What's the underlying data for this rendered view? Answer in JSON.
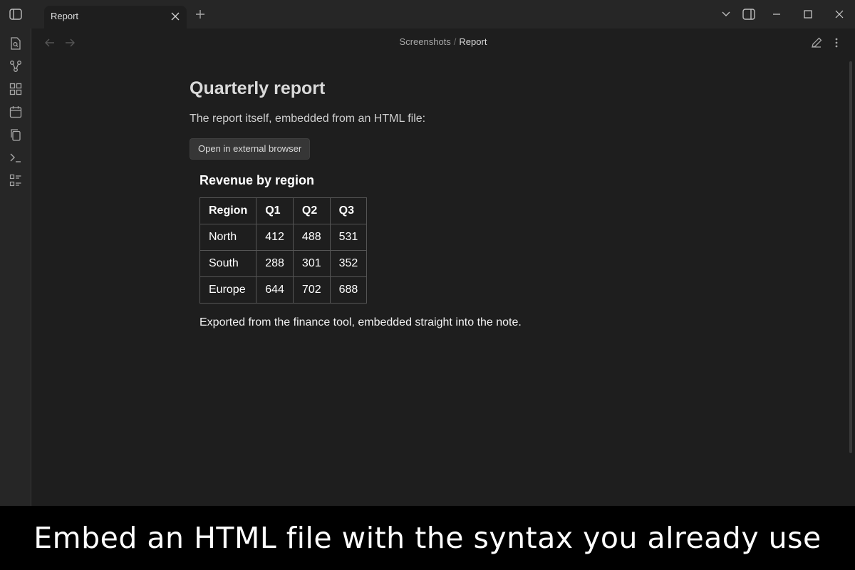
{
  "tab": {
    "title": "Report"
  },
  "breadcrumb": {
    "parent": "Screenshots",
    "separator": "/",
    "current": "Report"
  },
  "note": {
    "title": "Quarterly report",
    "paragraph": "The report itself, embedded from an HTML file:",
    "button_label": "Open in external browser"
  },
  "embed": {
    "heading": "Revenue by region",
    "table": {
      "headers": [
        "Region",
        "Q1",
        "Q2",
        "Q3"
      ],
      "rows": [
        [
          "North",
          "412",
          "488",
          "531"
        ],
        [
          "South",
          "288",
          "301",
          "352"
        ],
        [
          "Europe",
          "644",
          "702",
          "688"
        ]
      ]
    },
    "caption": "Exported from the finance tool, embedded straight into the note."
  },
  "banner": {
    "text": "Embed an HTML file with the syntax you already use"
  },
  "ribbon_icons": [
    "file-search-icon",
    "graph-icon",
    "grid-icon",
    "calendar-icon",
    "copy-icon",
    "terminal-icon",
    "list-icon"
  ],
  "colors": {
    "background": "#1e1e1e",
    "chrome": "#262626",
    "banner": "#000000"
  }
}
